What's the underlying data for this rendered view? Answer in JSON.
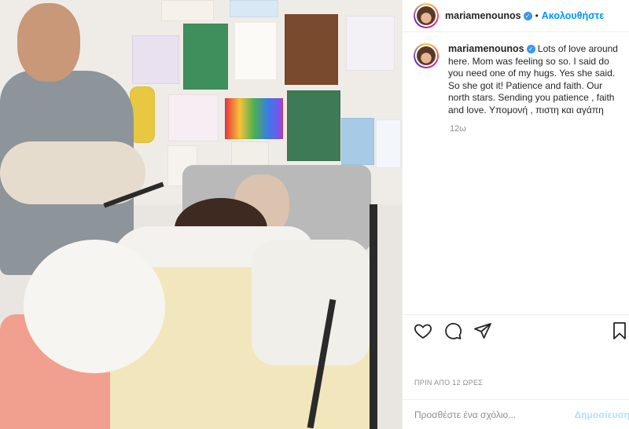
{
  "header": {
    "username": "mariamenounos",
    "separator": "•",
    "follow_label": "Ακολουθήστε"
  },
  "caption": {
    "username": "mariamenounos",
    "text": "Lots of love around here. Mom was feeling so so. I said do you need one of my hugs. Yes she said. So she got it! Patience and faith. Our north stars. Sending you patience , faith and love. Υπομονή , πιστη και αγάπη",
    "time": "12ω"
  },
  "actions": {
    "date": "ΠΡΙΝ ΑΠΟ 12 ΩΡΕΣ"
  },
  "comment": {
    "placeholder": "Προσθέστε ένα σχόλιο...",
    "post_label": "Δημοσίευση"
  },
  "icons": {
    "verified": "verified-badge-icon",
    "like": "heart-icon",
    "comment": "speech-bubble-icon",
    "share": "paper-plane-icon",
    "save": "bookmark-icon"
  },
  "colors": {
    "accent": "#0095f6",
    "verified": "#3897f0",
    "muted": "#8e8e8e",
    "post_disabled": "#b2dffc"
  }
}
